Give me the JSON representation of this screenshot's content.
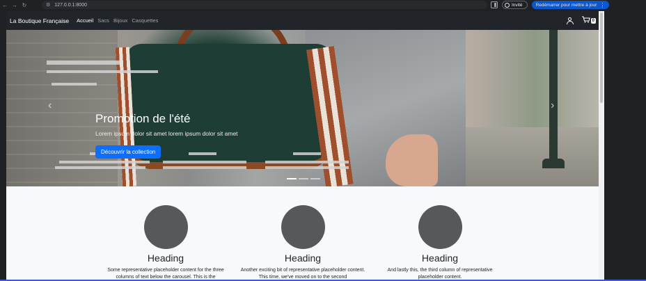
{
  "browser": {
    "url": "127.0.0.1:8000",
    "profile_label": "Invité",
    "update_label": "Redémarrer pour mettre à jour",
    "back_icon": "←",
    "forward_icon": "→",
    "reload_icon": "↻",
    "tune_icon": "⚙",
    "menu_icon": "⋮"
  },
  "navbar": {
    "brand": "La Boutique Française",
    "links": [
      "Accueil",
      "Sacs",
      "Bijoux",
      "Casquettes"
    ],
    "active_link": "Accueil",
    "cart_icon": "🛒",
    "cart_count": "0"
  },
  "carousel": {
    "title": "Promotion de l'été",
    "subtitle": "Lorem ipsum dolor sit amet lorem ipsum dolor sit amet",
    "cta_label": "Découvrir la collection",
    "prev_icon": "‹",
    "next_icon": "›",
    "slide_count": 3,
    "active_slide": 1
  },
  "marketing": {
    "columns": [
      {
        "heading": "Heading",
        "text": "Some representative placeholder content for the three columns of text below the carousel. This is the"
      },
      {
        "heading": "Heading",
        "text": "Another exciting bit of representative placeholder content. This time, we've moved on to the second"
      },
      {
        "heading": "Heading",
        "text": "And lastly this, the third column of representative placeholder content."
      }
    ]
  },
  "colors": {
    "navbar_bg": "#212529",
    "primary": "#0d6efd",
    "placeholder_circle": "#55595c",
    "browser_bg": "#202124",
    "update_button": "#0b57d0"
  }
}
